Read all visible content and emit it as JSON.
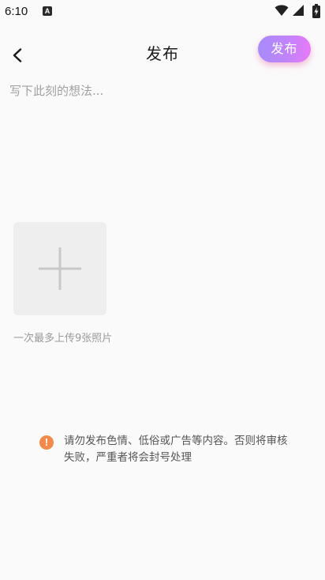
{
  "status_bar": {
    "time": "6:10",
    "app_icon_letter": "A"
  },
  "header": {
    "title": "发布",
    "publish_label": "发布"
  },
  "editor": {
    "placeholder": "写下此刻的想法..."
  },
  "photos": {
    "hint": "一次最多上传9张照片"
  },
  "warning": {
    "text": "请勿发布色情、低俗或广告等内容。否则将审核失败，严重者将会封号处理"
  }
}
